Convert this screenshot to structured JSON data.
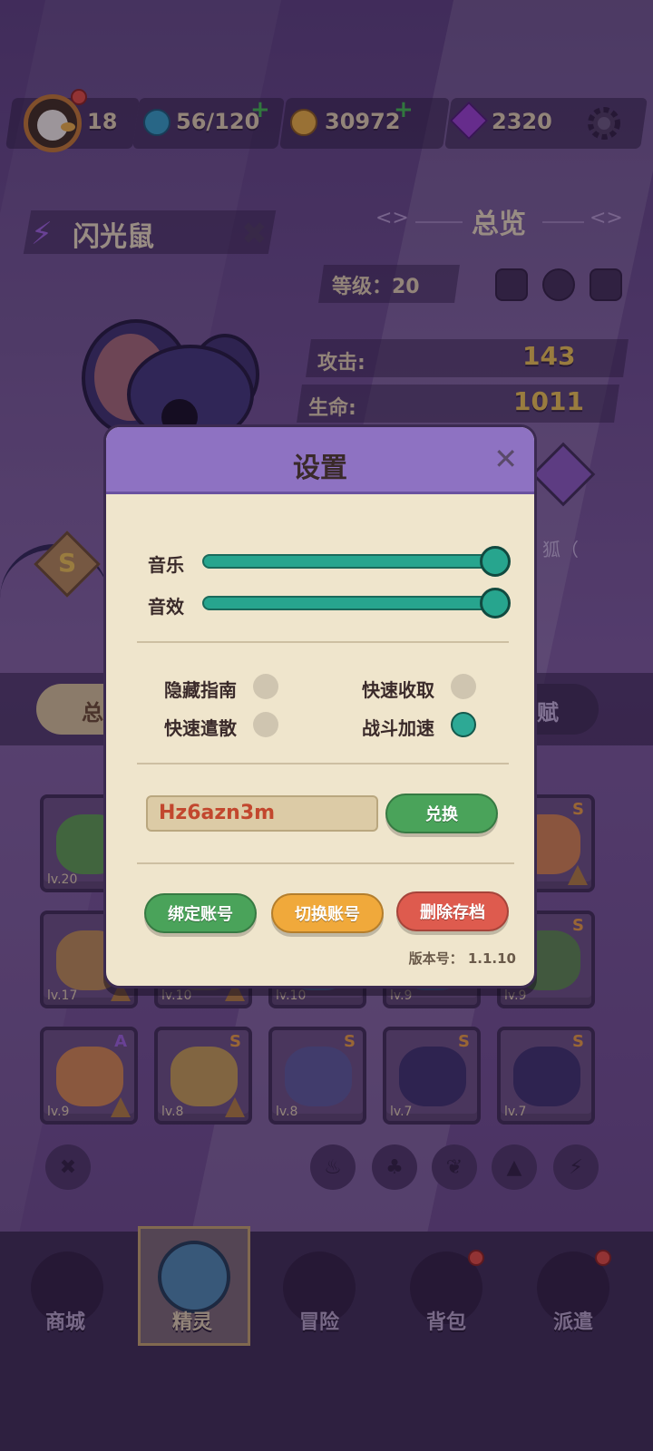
{
  "topbar": {
    "level": "18",
    "energy": "56/120",
    "coins": "30972",
    "gems": "2320",
    "settings_icon": "gear-icon"
  },
  "hero": {
    "name": "闪光鼠",
    "overview_title": "总览",
    "level_label": "等级：20",
    "attack_label": "攻击:",
    "attack_value": "143",
    "hp_label": "生命:",
    "hp_value": "1011",
    "rank": "S",
    "side_text": "狐（"
  },
  "tabs": {
    "left": "总",
    "right": "赋"
  },
  "grid": {
    "cards": [
      {
        "lv": "lv.20",
        "rank": ""
      },
      {
        "lv": "",
        "rank": "S"
      },
      {
        "lv": "lv.17",
        "rank": ""
      },
      {
        "lv": "lv.10",
        "rank": ""
      },
      {
        "lv": "lv.10",
        "rank": ""
      },
      {
        "lv": "lv.9",
        "rank": ""
      },
      {
        "lv": "lv.9",
        "rank": "S"
      },
      {
        "lv": "lv.9",
        "rank": "A"
      },
      {
        "lv": "lv.8",
        "rank": "S"
      },
      {
        "lv": "lv.8",
        "rank": "S"
      },
      {
        "lv": "lv.7",
        "rank": "S"
      },
      {
        "lv": "lv.7",
        "rank": "S"
      }
    ]
  },
  "nav": {
    "shop": "商城",
    "spirits": "精灵",
    "adventure": "冒险",
    "bag": "背包",
    "dispatch": "派遣"
  },
  "dialog": {
    "title": "设置",
    "music_label": "音乐",
    "sfx_label": "音效",
    "music_level": 1.0,
    "sfx_level": 1.0,
    "hide_guide_label": "隐藏指南",
    "hide_guide_on": false,
    "quick_collect_label": "快速收取",
    "quick_collect_on": false,
    "quick_dismiss_label": "快速遣散",
    "quick_dismiss_on": false,
    "battle_speed_label": "战斗加速",
    "battle_speed_on": true,
    "redeem_code": "Hz6azn3m",
    "redeem_button": "兑换",
    "bind_button": "绑定账号",
    "switch_button": "切换账号",
    "delete_button": "删除存档",
    "version_label": "版本号：",
    "version": "1.1.10"
  },
  "colors": {
    "accent": "#8e72c2",
    "teal": "#27a58e",
    "green": "#4aa35a",
    "orange": "#f0a93b",
    "red": "#de5b4e"
  }
}
